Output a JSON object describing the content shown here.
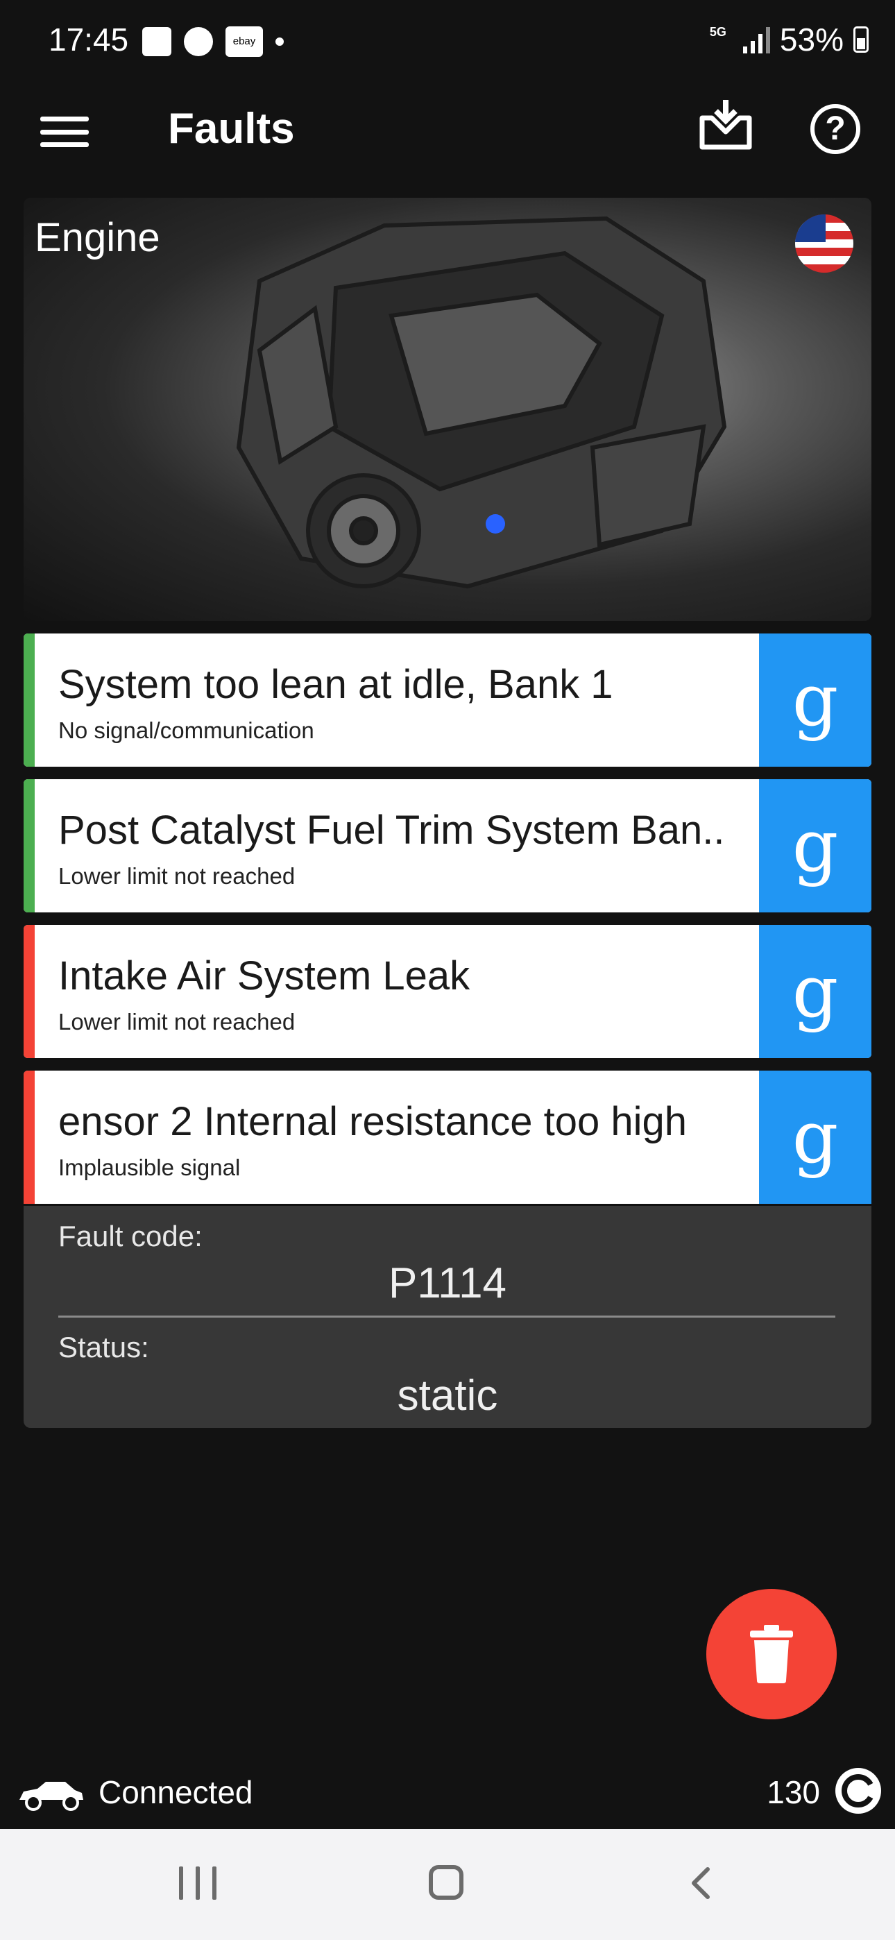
{
  "status_bar": {
    "time": "17:45",
    "battery": "53%",
    "network": "5G",
    "notification_ebay": "ebay"
  },
  "app_bar": {
    "title": "Faults"
  },
  "engine_card": {
    "label": "Engine"
  },
  "faults": [
    {
      "title": "System too lean at idle, Bank 1",
      "subtitle": "No signal/communication",
      "indicator_color": "#4caf50",
      "search_glyph": "g"
    },
    {
      "title": "Post Catalyst Fuel Trim System Ban..",
      "subtitle": "Lower limit not reached",
      "indicator_color": "#4caf50",
      "search_glyph": "g"
    },
    {
      "title": "Intake Air System Leak",
      "subtitle": "Lower limit not reached",
      "indicator_color": "#f44336",
      "search_glyph": "g"
    },
    {
      "title": "ensor 2 Internal resistance too high",
      "subtitle": "Implausible signal",
      "indicator_color": "#f44336",
      "search_glyph": "g"
    }
  ],
  "detail": {
    "fault_code_label": "Fault code:",
    "fault_code": "P1114",
    "status_label": "Status:",
    "status": "static"
  },
  "footer": {
    "connection_status": "Connected",
    "counter": "130"
  },
  "colors": {
    "accent_blue": "#2196f3",
    "delete_red": "#f44336",
    "ok_green": "#4caf50"
  }
}
